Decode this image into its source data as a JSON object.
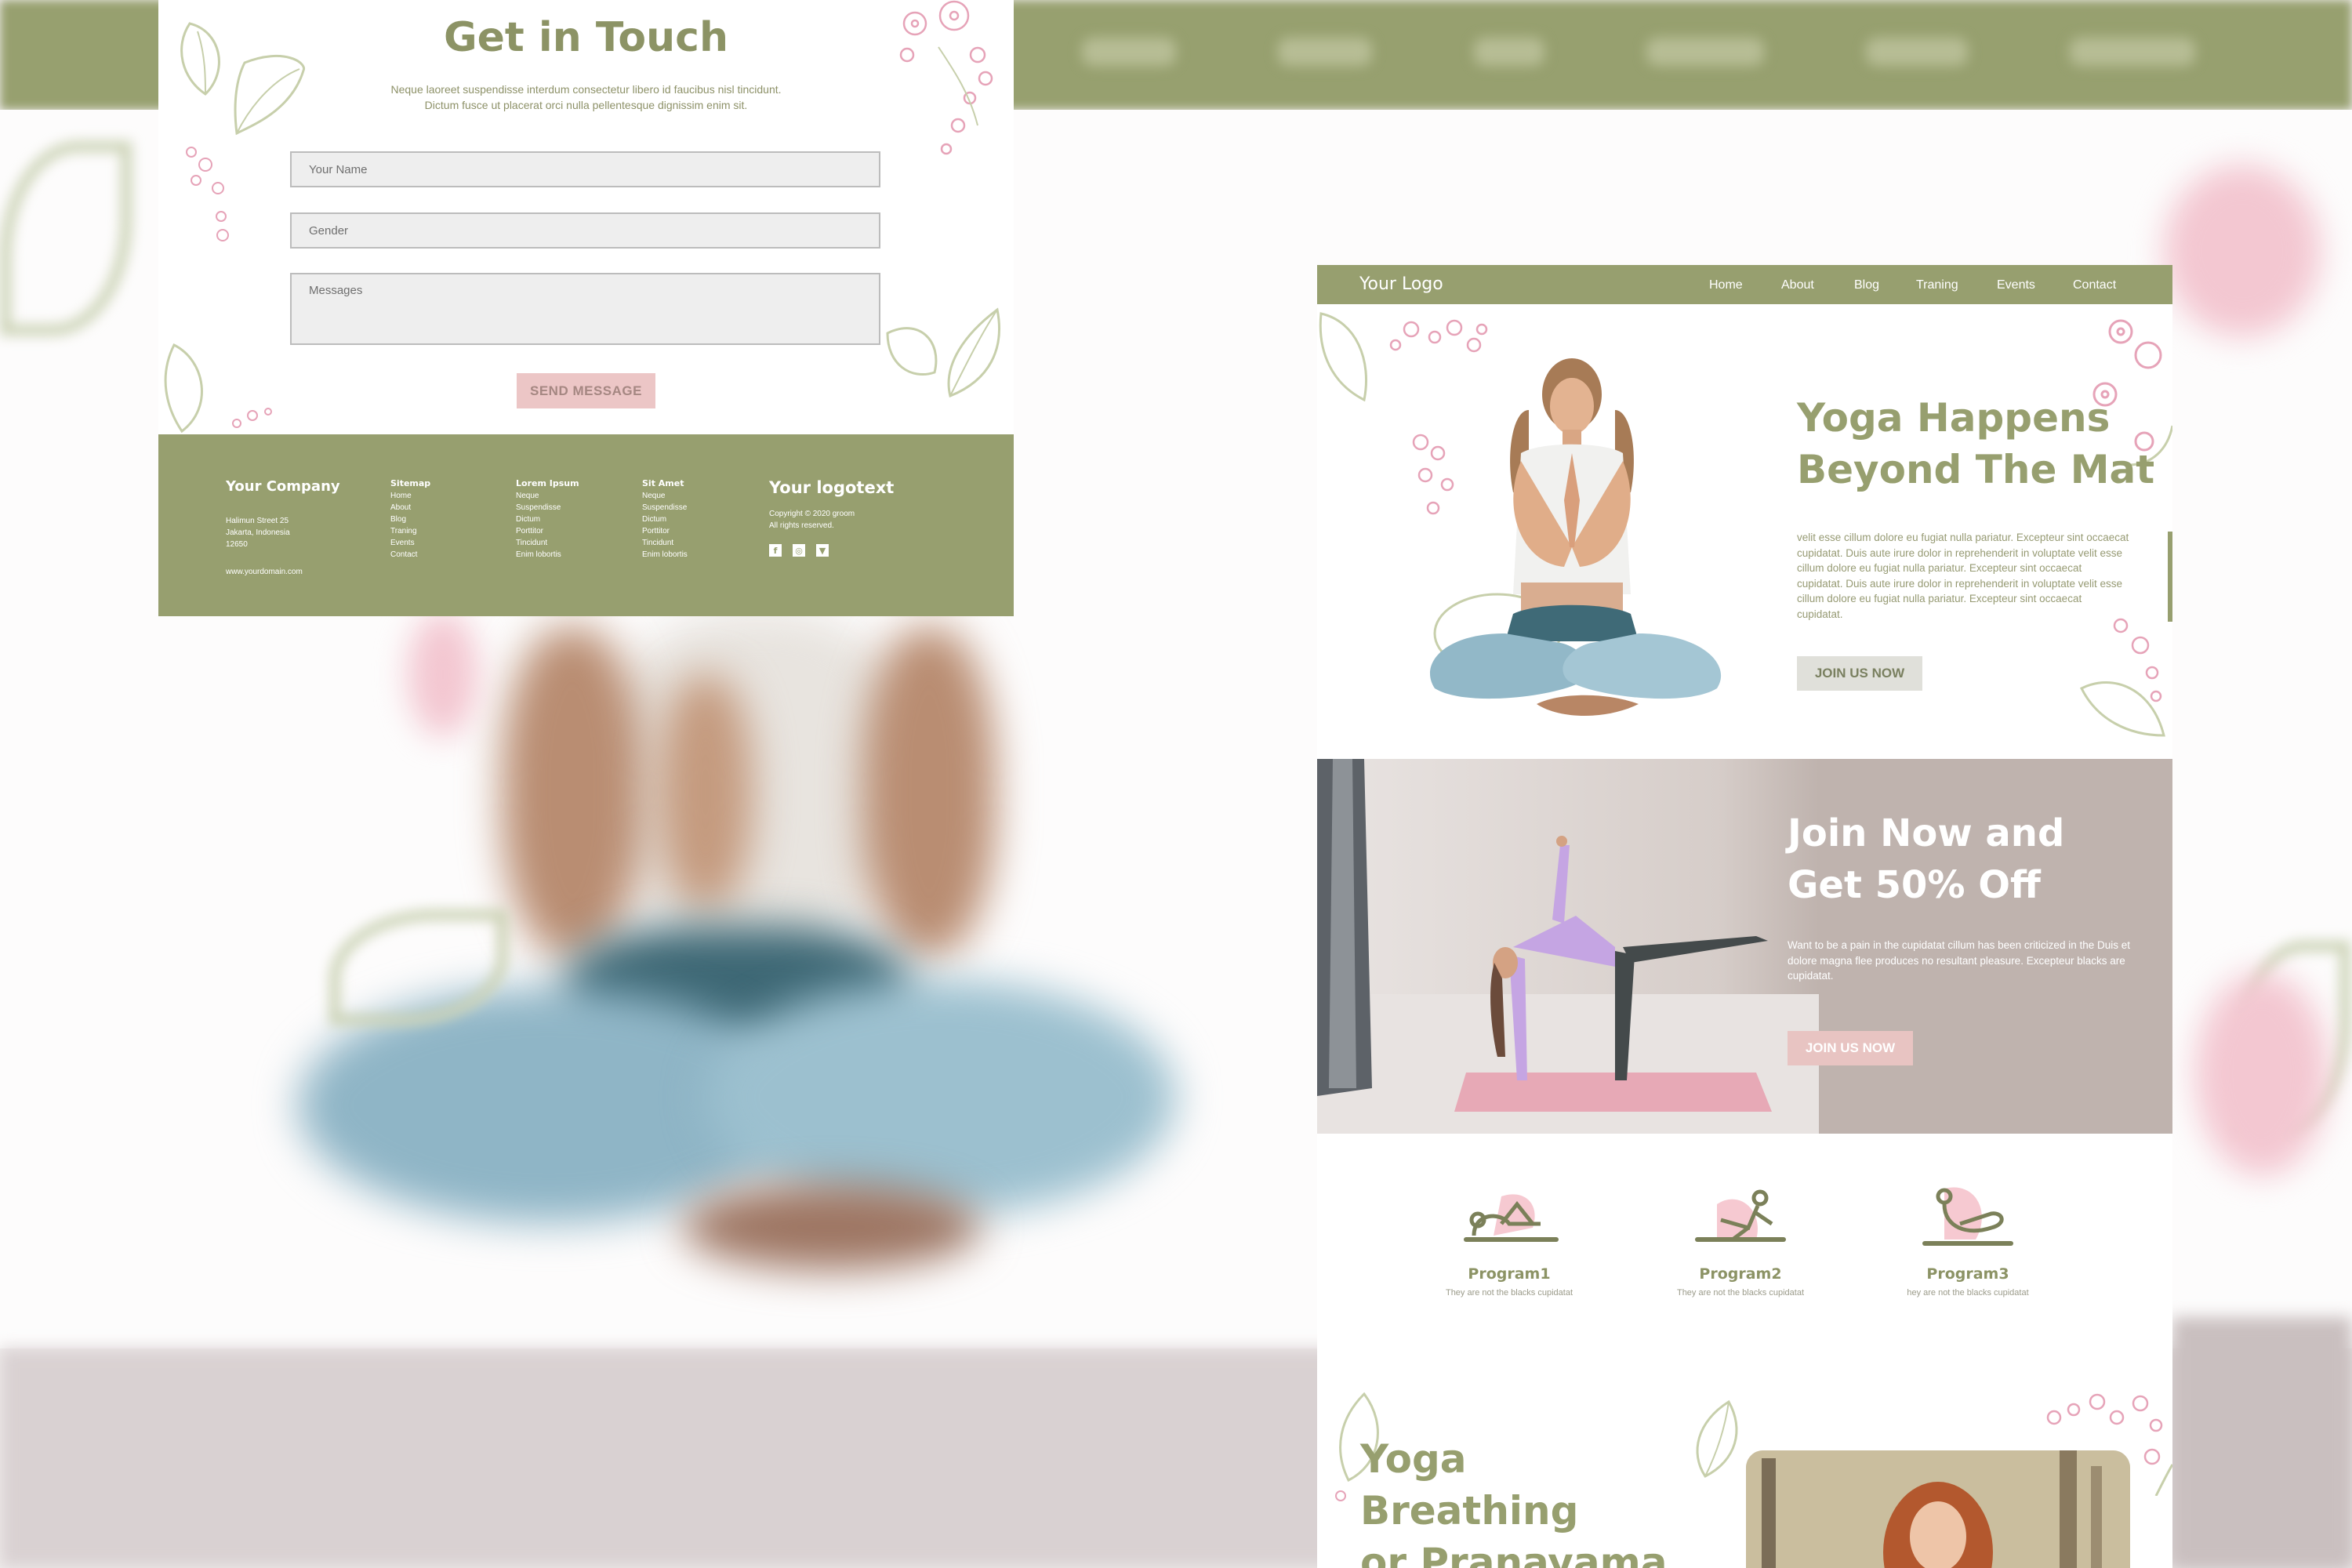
{
  "contact_card": {
    "title": "Get in Touch",
    "description_line1": "Neque laoreet suspendisse interdum consectetur libero id faucibus nisl tincidunt.",
    "description_line2": "Dictum fusce ut placerat orci nulla pellentesque dignissim enim sit.",
    "name_placeholder": "Your Name",
    "gender_placeholder": "Gender",
    "messages_placeholder": "Messages",
    "send_label": "SEND MESSAGE",
    "footer": {
      "company": "Your Company",
      "address": [
        "Halimun Street 25",
        "Jakarta, Indonesia",
        "12650"
      ],
      "website": "www.yourdomain.com",
      "sitemap": {
        "heading": "Sitemap",
        "links": [
          "Home",
          "About",
          "Blog",
          "Traning",
          "Events",
          "Contact"
        ]
      },
      "lorem": {
        "heading": "Lorem Ipsum",
        "links": [
          "Neque",
          "Suspendisse",
          "Dictum",
          "Porttitor",
          "Tincidunt",
          "Enim lobortis"
        ]
      },
      "sitamet": {
        "heading": "Sit Amet",
        "links": [
          "Neque",
          "Suspendisse",
          "Dictum",
          "Porttitor",
          "Tincidunt",
          "Enim lobortis"
        ]
      },
      "logotext": "Your logotext",
      "copyright": [
        "Copyright © 2020 groom",
        "All rights reserved."
      ],
      "social": [
        "f",
        "◎",
        "▼"
      ]
    }
  },
  "landing_card": {
    "logo": "Your Logo",
    "nav": [
      "Home",
      "About",
      "Blog",
      "Traning",
      "Events",
      "Contact"
    ],
    "hero": {
      "title_line1": "Yoga Happens",
      "title_line2": "Beyond The Mat",
      "text": "velit esse cillum dolore eu fugiat nulla pariatur. Excepteur sint occaecat cupidatat. Duis aute irure dolor in reprehenderit in voluptate velit esse cillum dolore eu fugiat nulla pariatur. Excepteur sint occaecat cupidatat. Duis aute irure dolor in reprehenderit in voluptate velit esse cillum dolore eu fugiat nulla pariatur. Excepteur sint occaecat cupidatat.",
      "button": "JOIN US NOW"
    },
    "promo": {
      "title_line1": "Join Now and",
      "title_line2": "Get 50% Off",
      "text": "Want to be a pain in the cupidatat cillum has been criticized in the Duis et dolore magna flee produces no resultant pleasure. Excepteur blacks are cupidatat.",
      "button": "JOIN US NOW"
    },
    "programs": [
      {
        "name": "Program1",
        "desc": "They are not the blacks cupidatat"
      },
      {
        "name": "Program2",
        "desc": "They are not the blacks cupidatat"
      },
      {
        "name": "Program3",
        "desc": "hey are not the blacks cupidatat"
      }
    ],
    "breathing": {
      "title_line1": "Yoga Breathing",
      "title_line2": "or Pranayama"
    }
  },
  "colors": {
    "olive": "#979f6f",
    "olive_text": "#8c9365",
    "blush": "#ecc6c6",
    "taupe": "#bfb3ae",
    "white": "#ffffff"
  },
  "icons": [
    "leaf-icon",
    "flower-icon",
    "facebook-icon",
    "instagram-icon",
    "twitter-icon",
    "yoga-pose-icon"
  ]
}
